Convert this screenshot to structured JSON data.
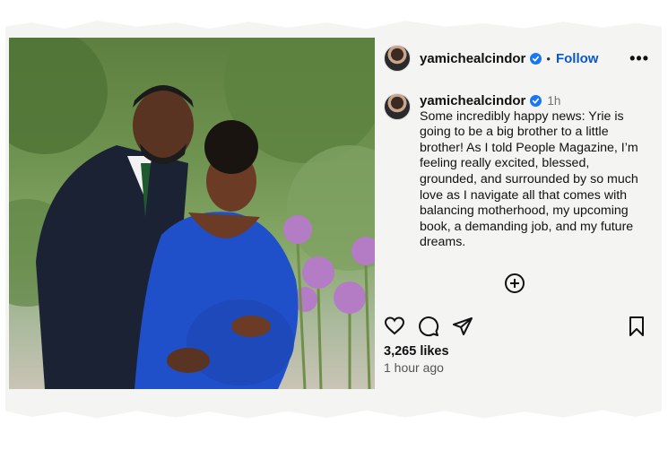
{
  "profile": {
    "username": "yamichealcindor",
    "follow_label": "Follow",
    "separator": "•",
    "more_label": "•••"
  },
  "caption": {
    "username": "yamichealcindor",
    "time": "1h",
    "text": "Some incredibly happy news: Yrie is going to be a big brother to a little brother! As I told People Magazine, I’m feeling really excited, blessed, grounded, and surrounded by so much love as I navigate all that comes with balancing motherhood, my upcoming book, a demanding job, and my future dreams."
  },
  "stats": {
    "likes": "3,265 likes",
    "posted": "1 hour ago"
  },
  "icons": {
    "verified": "verified-badge-icon",
    "add_comment": "plus-circle-icon",
    "like": "heart-icon",
    "comment": "speech-bubble-icon",
    "share": "paper-plane-icon",
    "save": "bookmark-icon"
  },
  "colors": {
    "follow": "#0b57d0",
    "verified": "#1877f2",
    "dress": "#1f4fc9"
  }
}
